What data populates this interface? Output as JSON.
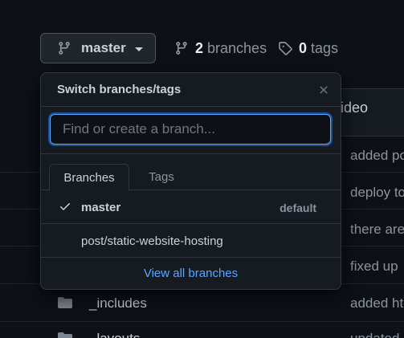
{
  "branch_button": {
    "label": "master",
    "icon": "git-branch-icon"
  },
  "branches_link": {
    "count": "2",
    "label": "branches",
    "icon": "git-branch-icon"
  },
  "tags_link": {
    "count": "0",
    "label": "tags",
    "icon": "tag-icon"
  },
  "background": {
    "header_text": "ideo",
    "commit_messages": [
      "added po",
      "deploy to",
      "there are",
      "fixed up",
      "added ht",
      "updated"
    ],
    "folders": [
      "_includes",
      "_layouts"
    ]
  },
  "dropdown": {
    "title": "Switch branches/tags",
    "filter_placeholder": "Find or create a branch...",
    "tabs": [
      {
        "label": "Branches",
        "active": true
      },
      {
        "label": "Tags",
        "active": false
      }
    ],
    "items": [
      {
        "name": "master",
        "selected": true,
        "tag": "default"
      },
      {
        "name": "post/static-website-hosting",
        "selected": false,
        "tag": ""
      }
    ],
    "footer_link": "View all branches"
  },
  "colors": {
    "background": "#0d1117",
    "panel": "#161b22",
    "border": "#30363d",
    "link": "#58a6ff",
    "text": "#c9d1d9",
    "muted": "#8b949e"
  }
}
